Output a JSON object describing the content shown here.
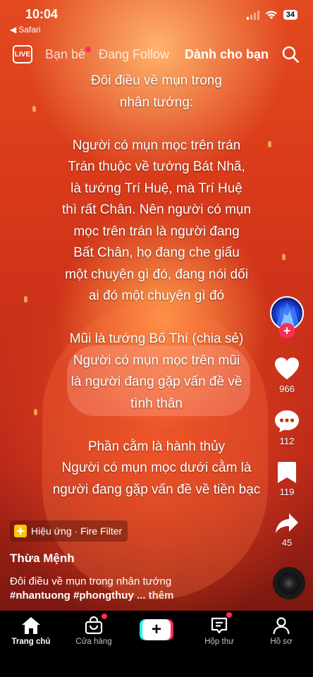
{
  "status_bar": {
    "time": "10:04",
    "back_app": "Safari",
    "battery": "34"
  },
  "top_nav": {
    "live_label": "LIVE",
    "tabs": [
      {
        "label": "Bạn bè",
        "has_dot": true
      },
      {
        "label": "Đang Follow",
        "has_dot": false
      },
      {
        "label": "Dành cho bạn",
        "active": true
      }
    ]
  },
  "caption_lines": [
    "Đôi điều về mụn trong",
    "nhân tướng:",
    "",
    "Người có mụn mọc trên trán",
    "Trán thuộc về tướng Bát Nhã,",
    "là tướng Trí Huệ, mà Trí Huệ",
    "thì rất Chân. Nên người có mụn",
    "mọc trên trán là người đang",
    "Bất Chân, họ đang che giấu",
    "một chuyện gì đó, đang nói dối",
    "ai đó một chuyện gì đó",
    "",
    "Mũi là tướng Bố Thí (chia sẻ)",
    "Người có mụn mọc trên mũi",
    "là người đang gặp vấn đề về",
    "tình thân",
    "",
    "Phần cằm là hành thủy",
    "Người có mụn mọc dưới cằm là",
    "người đang gặp vấn đề về tiền bạc"
  ],
  "rail": {
    "likes": "966",
    "comments": "112",
    "saves": "119",
    "shares": "45"
  },
  "effect": {
    "label": "Hiệu ứng · Fire Filter"
  },
  "post": {
    "username": "Thừa Mệnh",
    "description": "Đôi điều về mụn trong nhân tướng",
    "hashtags": "#nhantuong #phongthuy",
    "more": "... thêm"
  },
  "bottom_nav": {
    "home": "Trang chủ",
    "shop": "Cửa hàng",
    "inbox": "Hộp thư",
    "profile": "Hồ sơ"
  },
  "colors": {
    "accent": "#fe2c55",
    "cyan": "#25f4ee"
  }
}
